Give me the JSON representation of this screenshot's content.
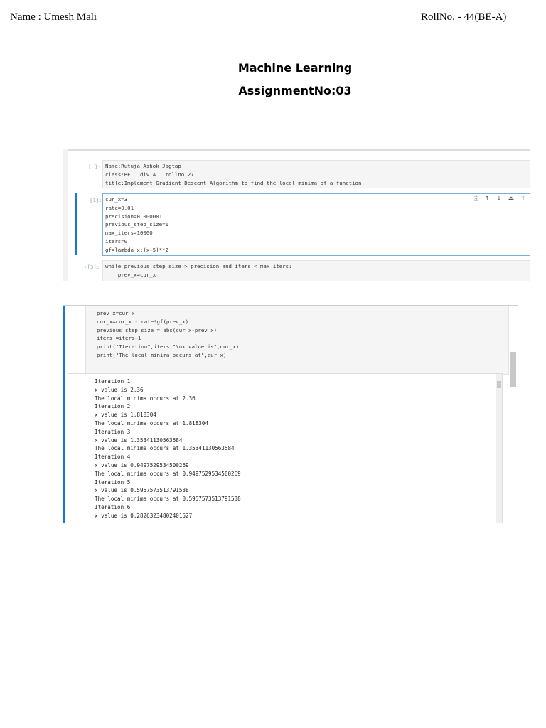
{
  "header": {
    "name": "Name : Umesh Mali",
    "roll": "RollNo. - 44(BE-A)"
  },
  "title": {
    "line1": "Machine Learning",
    "line2": "AssignmentNo:03"
  },
  "notebook1": {
    "cell1": {
      "prompt": "[ ]:",
      "lines": [
        "Name:Rutuja Ashok Jagtap",
        "class:BE   div:A   rollno:27",
        "title:Implement Gradient Descent Algorithm to find the local minima of a function."
      ]
    },
    "cell2": {
      "prompt": "[1]:",
      "lines": [
        "cur_x=3",
        "rate=0.01",
        "precision=0.000001",
        "previous_step_size=1",
        "max_iters=10000",
        "iters=0",
        "gf=lambda x:(x+5)**2"
      ]
    },
    "cell3": {
      "prompt": "•[3]:",
      "lines": [
        "while previous_step_size > precision and iters < max_iters:",
        "    prev_x=cur_x"
      ]
    },
    "toolbar_icons": [
      "copy-icon",
      "arrow-up-icon",
      "arrow-down-icon",
      "insert-above-icon",
      "insert-below-icon"
    ]
  },
  "notebook2": {
    "code_lines": [
      "prev_x=cur_x",
      "cur_x=cur_x - rate*gf(prev_x)",
      "previous_step_size = abs(cur_x-prev_x)",
      "iters =iters+1",
      "print(\"Iteration\",iters,\"\\nx value is\",cur_x)",
      "print(\"The local minima occurs at\",cur_x)"
    ],
    "output_lines": [
      "Iteration 1",
      "x value is 2.36",
      "The local minima occurs at 2.36",
      "Iteration 2",
      "x value is 1.818304",
      "The local minima occurs at 1.818304",
      "Iteration 3",
      "x value is 1.35341130563584",
      "The local minima occurs at 1.35341130563584",
      "Iteration 4",
      "x value is 0.9497529534500269",
      "The local minima occurs at 0.9497529534500269",
      "Iteration 5",
      "x value is 0.5957573513791538",
      "The local minima occurs at 0.5957573513791538",
      "Iteration 6",
      "x value is 0.28263234802401527"
    ]
  },
  "colors": {
    "accent": "#1976d2",
    "code_bg": "#f5f5f5"
  }
}
